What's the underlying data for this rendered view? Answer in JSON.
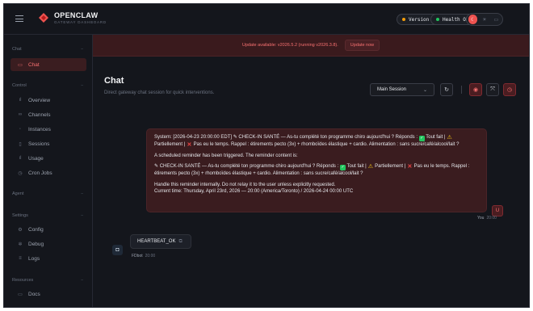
{
  "app": {
    "title": "OPENCLAW",
    "subtitle": "GATEWAY DASHBOARD",
    "version_label": "Version 2026.3.8",
    "health_label": "Health OK",
    "colors": {
      "accent": "#ef5350",
      "version_dot": "#f59e0b",
      "health_dot": "#22c55e"
    },
    "theme_options": [
      "moon-icon",
      "sun-icon",
      "monitor-icon"
    ]
  },
  "sidebar": {
    "sections": {
      "chat": "Chat",
      "control": "Control",
      "agent": "Agent",
      "settings": "Settings",
      "resources": "Resources"
    },
    "items": [
      {
        "label": "Chat",
        "icon": "chat-bubble-icon",
        "active": true
      },
      {
        "label": "Overview",
        "icon": "bar-chart-icon"
      },
      {
        "label": "Channels",
        "icon": "link-icon"
      },
      {
        "label": "Instances",
        "icon": "radio-icon"
      },
      {
        "label": "Sessions",
        "icon": "document-icon"
      },
      {
        "label": "Usage",
        "icon": "bar-chart-icon"
      },
      {
        "label": "Cron Jobs",
        "icon": "clock-icon"
      },
      {
        "label": "Config",
        "icon": "gear-icon"
      },
      {
        "label": "Debug",
        "icon": "bug-icon"
      },
      {
        "label": "Logs",
        "icon": "file-text-icon"
      },
      {
        "label": "Docs",
        "icon": "book-icon"
      }
    ]
  },
  "banner": {
    "text": "Update available: v2026.5.2 (running v2026.3.8).",
    "button": "Update now"
  },
  "main": {
    "title": "Chat",
    "subtitle": "Direct gateway chat session for quick interventions.",
    "session_select": "Main Session"
  },
  "messages": {
    "user": {
      "line1_a": "System: [2026-04-23 20:00:00 EDT] ",
      "line1_b": " CHECK-IN SANTÉ — As-tu complété ton programme chiro aujourd'hui ? Réponds : ",
      "line1_c": " Tout fait | ",
      "line1_d": " Partiellement | ",
      "line1_e": " Pas eu le temps. Rappel : étirements pecto (3x) + rhomboïdes élastique + cardio. Alimentation : sans sucre/café/alcool/lait ?",
      "reminder": "A scheduled reminder has been triggered. The reminder content is:",
      "line3_b": " CHECK-IN SANTÉ — As-tu complété ton programme chiro aujourd'hui ? Réponds : ",
      "line3_c": " Tout fait | ",
      "line3_d": " Partiellement | ",
      "line3_e": " Pas eu le temps. Rappel : étirements pecto (3x) + rhomboïdes élastique + cardio. Alimentation : sans sucre/café/alcool/lait ?",
      "handle": "Handle this reminder internally. Do not relay it to the user unless explicitly requested.",
      "current_time": "Current time: Thursday, April 23rd, 2026 — 20:00 (America/Toronto) / 2026-04-24 00:00 UTC",
      "author": "You",
      "time": "20:00",
      "avatar": "U"
    },
    "bot": {
      "text": "HEARTBEAT_OK",
      "author": "FDbot",
      "time": "20:00"
    }
  }
}
